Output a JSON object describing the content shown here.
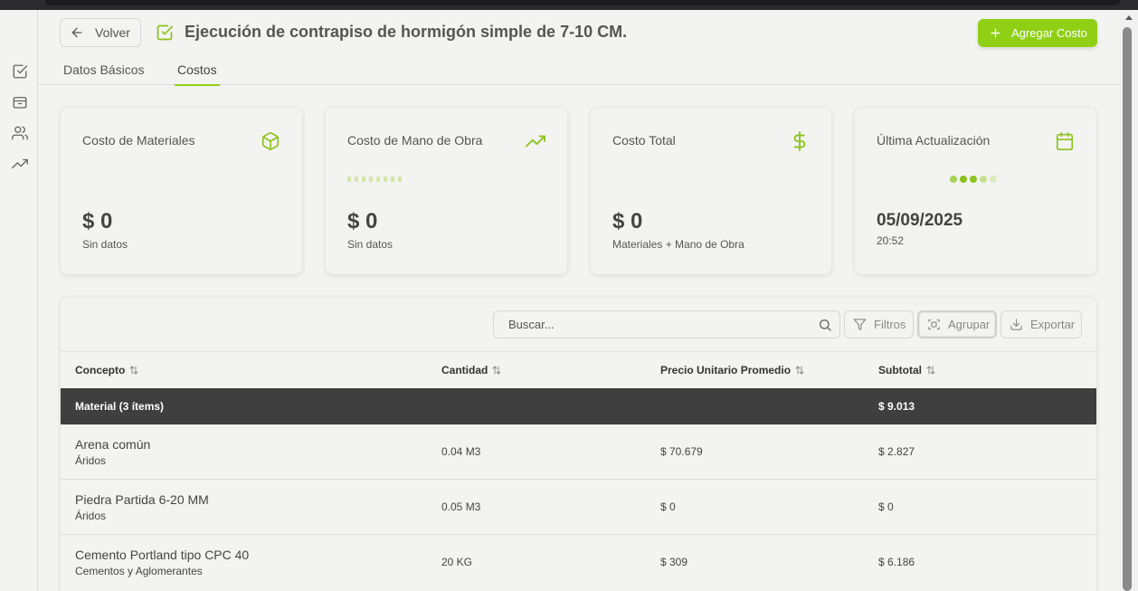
{
  "header": {
    "back_label": "Volver",
    "title": "Ejecución de contrapiso de hormigón simple de 7-10 CM.",
    "add_label": "Agregar Costo"
  },
  "tabs": [
    {
      "label": "Datos Básicos",
      "active": false
    },
    {
      "label": "Costos",
      "active": true
    }
  ],
  "sidebar": {
    "icons": [
      "checkbox-icon",
      "package-icon",
      "users-icon",
      "trending-icon"
    ]
  },
  "cards": [
    {
      "label": "Costo de Materiales",
      "icon": "box-icon",
      "value": "$ 0",
      "sub": "Sin datos"
    },
    {
      "label": "Costo de Mano de Obra",
      "icon": "trending-up-icon",
      "value": "$ 0",
      "sub": "Sin datos"
    },
    {
      "label": "Costo Total",
      "icon": "dollar-icon",
      "value": "$ 0",
      "sub": "Materiales + Mano de Obra"
    },
    {
      "label": "Última Actualización",
      "icon": "calendar-icon",
      "date": "05/09/2025",
      "time": "20:52"
    }
  ],
  "toolbar": {
    "search_placeholder": "Buscar...",
    "filters_label": "Filtros",
    "group_label": "Agrupar",
    "export_label": "Exportar"
  },
  "table": {
    "columns": [
      "Concepto",
      "Cantidad",
      "Precio Unitario Promedio",
      "Subtotal"
    ],
    "group": {
      "label": "Material (3 ítems)",
      "subtotal": "$ 9.013"
    },
    "rows": [
      {
        "name": "Arena común",
        "category": "Áridos",
        "quantity": "0.04 M3",
        "unit_price": "$ 70.679",
        "subtotal": "$ 2.827"
      },
      {
        "name": "Piedra Partida 6-20 MM",
        "category": "Áridos",
        "quantity": "0.05 M3",
        "unit_price": "$ 0",
        "subtotal": "$ 0"
      },
      {
        "name": "Cemento Portland tipo CPC 40",
        "category": "Cementos y Aglomerantes",
        "quantity": "20 KG",
        "unit_price": "$ 309",
        "subtotal": "$ 6.186"
      }
    ]
  },
  "colors": {
    "accent": "#8fd014",
    "group_row": "#3f3f3f",
    "background": "#f3f3f1"
  }
}
